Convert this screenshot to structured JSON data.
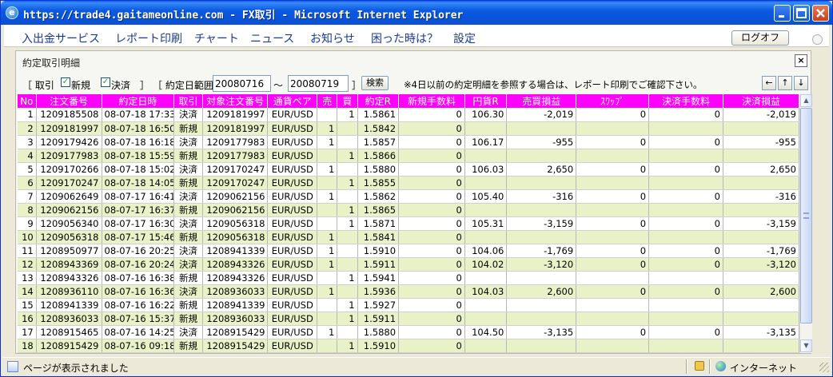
{
  "window": {
    "title": "https://trade4.gaitameonline.com - FX取引 - Microsoft Internet Explorer"
  },
  "menu": {
    "items": [
      "入出金サービス",
      "レポート印刷",
      "チャート",
      "ニュース",
      "お知らせ",
      "困った時は？",
      "設定"
    ],
    "logout": "ログオフ"
  },
  "panel": {
    "title": "約定取引明細",
    "close": "×"
  },
  "filter": {
    "torihiki_open": "［ 取引",
    "new_label": "新規",
    "settle_label": "決済",
    "torihiki_close": "］",
    "range_label": "［ 約定日範囲",
    "date_from": "20080716",
    "tilde": "〜",
    "date_to": "20080719",
    "range_close": "］",
    "search": "検索",
    "note": "※4日以前の約定明細を参照する場合は、レポート印刷でご確認下さい。",
    "nav_left": "←",
    "nav_up": "↑",
    "nav_down": "↓"
  },
  "table": {
    "columns": [
      "No",
      "注文番号",
      "約定日時",
      "取引",
      "対象注文番号",
      "通貨ペア",
      "売",
      "買",
      "約定R",
      "新規手数料",
      "円貨R",
      "売買損益",
      "ｽﾜｯﾌﾟ",
      "決済手数料",
      "決済損益"
    ],
    "rows": [
      [
        "1",
        "1209185508",
        "08-07-18 17:33",
        "決済",
        "1209181997",
        "EUR/USD",
        "",
        "1",
        "1.5861",
        "0",
        "106.30",
        "-2,019",
        "0",
        "0",
        "-2,019"
      ],
      [
        "2",
        "1209181997",
        "08-07-18 16:50",
        "新規",
        "1209181997",
        "EUR/USD",
        "1",
        "",
        "1.5842",
        "0",
        "",
        "",
        "",
        "",
        ""
      ],
      [
        "3",
        "1209179426",
        "08-07-18 16:18",
        "決済",
        "1209177983",
        "EUR/USD",
        "1",
        "",
        "1.5857",
        "0",
        "106.17",
        "-955",
        "0",
        "0",
        "-955"
      ],
      [
        "4",
        "1209177983",
        "08-07-18 15:59",
        "新規",
        "1209177983",
        "EUR/USD",
        "",
        "1",
        "1.5866",
        "0",
        "",
        "",
        "",
        "",
        ""
      ],
      [
        "5",
        "1209170266",
        "08-07-18 15:02",
        "決済",
        "1209170247",
        "EUR/USD",
        "1",
        "",
        "1.5880",
        "0",
        "106.03",
        "2,650",
        "0",
        "0",
        "2,650"
      ],
      [
        "6",
        "1209170247",
        "08-07-18 14:05",
        "新規",
        "1209170247",
        "EUR/USD",
        "",
        "1",
        "1.5855",
        "0",
        "",
        "",
        "",
        "",
        ""
      ],
      [
        "7",
        "1209062649",
        "08-07-17 16:41",
        "決済",
        "1209062156",
        "EUR/USD",
        "1",
        "",
        "1.5862",
        "0",
        "105.40",
        "-316",
        "0",
        "0",
        "-316"
      ],
      [
        "8",
        "1209062156",
        "08-07-17 16:37",
        "新規",
        "1209062156",
        "EUR/USD",
        "",
        "1",
        "1.5865",
        "0",
        "",
        "",
        "",
        "",
        ""
      ],
      [
        "9",
        "1209056340",
        "08-07-17 16:30",
        "決済",
        "1209056318",
        "EUR/USD",
        "",
        "1",
        "1.5871",
        "0",
        "105.31",
        "-3,159",
        "0",
        "0",
        "-3,159"
      ],
      [
        "10",
        "1209056318",
        "08-07-17 15:46",
        "新規",
        "1209056318",
        "EUR/USD",
        "1",
        "",
        "1.5841",
        "0",
        "",
        "",
        "",
        "",
        ""
      ],
      [
        "11",
        "1208950977",
        "08-07-16 20:25",
        "決済",
        "1208941339",
        "EUR/USD",
        "1",
        "",
        "1.5910",
        "0",
        "104.06",
        "-1,769",
        "0",
        "0",
        "-1,769"
      ],
      [
        "12",
        "1208943369",
        "08-07-16 20:24",
        "決済",
        "1208943326",
        "EUR/USD",
        "1",
        "",
        "1.5911",
        "0",
        "104.02",
        "-3,120",
        "0",
        "0",
        "-3,120"
      ],
      [
        "13",
        "1208943326",
        "08-07-16 16:38",
        "新規",
        "1208943326",
        "EUR/USD",
        "",
        "1",
        "1.5941",
        "0",
        "",
        "",
        "",
        "",
        ""
      ],
      [
        "14",
        "1208936110",
        "08-07-16 16:36",
        "決済",
        "1208936033",
        "EUR/USD",
        "1",
        "",
        "1.5936",
        "0",
        "104.03",
        "2,600",
        "0",
        "0",
        "2,600"
      ],
      [
        "15",
        "1208941339",
        "08-07-16 16:22",
        "新規",
        "1208941339",
        "EUR/USD",
        "",
        "1",
        "1.5927",
        "0",
        "",
        "",
        "",
        "",
        ""
      ],
      [
        "16",
        "1208936033",
        "08-07-16 15:37",
        "新規",
        "1208936033",
        "EUR/USD",
        "",
        "1",
        "1.5911",
        "0",
        "",
        "",
        "",
        "",
        ""
      ],
      [
        "17",
        "1208915465",
        "08-07-16 14:25",
        "決済",
        "1208915429",
        "EUR/USD",
        "1",
        "",
        "1.5880",
        "0",
        "104.50",
        "-3,135",
        "0",
        "0",
        "-3,135"
      ],
      [
        "18",
        "1208915429",
        "08-07-16 09:18",
        "新規",
        "1208915429",
        "EUR/USD",
        "",
        "1",
        "1.5910",
        "0",
        "",
        "",
        "",
        "",
        ""
      ]
    ]
  },
  "status": {
    "text": "ページが表示されました",
    "zone": "インターネット"
  }
}
